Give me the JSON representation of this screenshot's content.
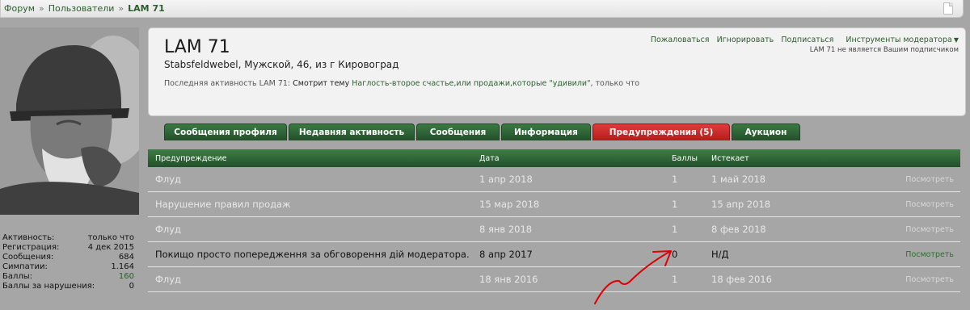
{
  "breadcrumb": {
    "items": [
      "Форум",
      "Пользователи"
    ],
    "current": "LAM 71",
    "separator": "»"
  },
  "profile": {
    "name": "LAM 71",
    "info_prefix": "Stabsfeldwebel, Мужской, 46,",
    "info_from": "из",
    "info_city": "г Кировоград",
    "activity_label": "Последняя активность LAM 71:",
    "activity_action": "Смотрит тему",
    "activity_topic": "Наглость-второе счастье,или продажи,которые \"удивили\"",
    "activity_suffix": ", только что",
    "actions": [
      "Пожаловаться",
      "Игнорировать",
      "Подписаться",
      "Инструменты модератора"
    ],
    "follow_note": "LAM 71 не является Вашим подписчиком"
  },
  "stats": [
    {
      "label": "Активность:",
      "value": "только что",
      "link": false
    },
    {
      "label": "Регистрация:",
      "value": "4 дек 2015",
      "link": false
    },
    {
      "label": "Сообщения:",
      "value": "684",
      "link": false
    },
    {
      "label": "Симпатии:",
      "value": "1.164",
      "link": false
    },
    {
      "label": "Баллы:",
      "value": "160",
      "link": true
    },
    {
      "label": "Баллы за нарушения:",
      "value": "0",
      "link": false
    }
  ],
  "tabs": [
    {
      "label": "Сообщения профиля",
      "active": false
    },
    {
      "label": "Недавняя активность",
      "active": false
    },
    {
      "label": "Сообщения",
      "active": false
    },
    {
      "label": "Информация",
      "active": false
    },
    {
      "label": "Предупреждения (5)",
      "active": true
    },
    {
      "label": "Аукцион",
      "active": false
    }
  ],
  "warnings": {
    "headers": [
      "Предупреждение",
      "Дата",
      "Баллы",
      "Истекает"
    ],
    "rows": [
      {
        "title": "Флуд",
        "date": "1 апр 2018",
        "points": "1",
        "expires": "1 май 2018",
        "action": "Посмотреть",
        "active": false
      },
      {
        "title": "Нарушение правил продаж",
        "date": "15 мар 2018",
        "points": "1",
        "expires": "15 апр 2018",
        "action": "Посмотреть",
        "active": false
      },
      {
        "title": "Флуд",
        "date": "8 янв 2018",
        "points": "1",
        "expires": "8 фев 2018",
        "action": "Посмотреть",
        "active": false
      },
      {
        "title": "Покищо просто попередження за обговорення дій модератора.",
        "date": "8 апр 2017",
        "points": "0",
        "expires": "Н/Д",
        "action": "Посмотреть",
        "active": true
      },
      {
        "title": "Флуд",
        "date": "18 янв 2016",
        "points": "1",
        "expires": "18 фев 2016",
        "action": "Посмотреть",
        "active": false
      }
    ]
  },
  "colors": {
    "accent_green": "#2d5c2f",
    "tab_green": "#2f6a37",
    "tab_active_red": "#c62828",
    "annotation_red": "#e00000"
  }
}
